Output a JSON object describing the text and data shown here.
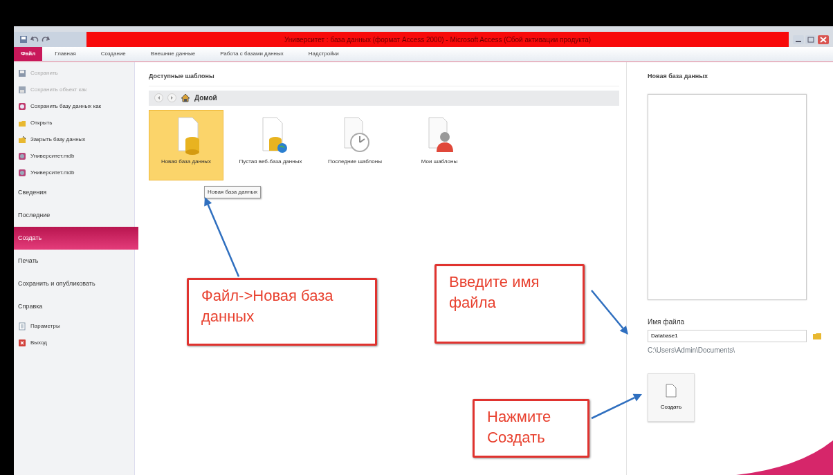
{
  "window": {
    "title": "Университет : база данных (формат Access 2000) - Microsoft Access (Сбой активации продукта)"
  },
  "ribbon_tabs": [
    {
      "label": "Файл",
      "selected": true
    },
    {
      "label": "Главная",
      "selected": false
    },
    {
      "label": "Создание",
      "selected": false
    },
    {
      "label": "Внешние данные",
      "selected": false
    },
    {
      "label": "Работа с базами данных",
      "selected": false
    },
    {
      "label": "Надстройки",
      "selected": false
    }
  ],
  "sidebar": {
    "items": [
      {
        "kind": "command",
        "label": "Сохранить",
        "disabled": true,
        "selected": false
      },
      {
        "kind": "command",
        "label": "Сохранить объект как",
        "disabled": true,
        "selected": false
      },
      {
        "kind": "command",
        "label": "Сохранить базу данных как",
        "disabled": false,
        "selected": false
      },
      {
        "kind": "command",
        "label": "Открыть",
        "disabled": false,
        "selected": false
      },
      {
        "kind": "command",
        "label": "Закрыть базу данных",
        "disabled": false,
        "selected": false
      },
      {
        "kind": "recent",
        "label": "Университет.mdb",
        "disabled": false,
        "selected": false
      },
      {
        "kind": "recent",
        "label": "Университет.mdb",
        "disabled": false,
        "selected": false
      },
      {
        "kind": "section",
        "label": "Сведения",
        "disabled": false,
        "selected": false
      },
      {
        "kind": "section",
        "label": "Последние",
        "disabled": false,
        "selected": false
      },
      {
        "kind": "section",
        "label": "Создать",
        "disabled": false,
        "selected": true
      },
      {
        "kind": "section",
        "label": "Печать",
        "disabled": false,
        "selected": false
      },
      {
        "kind": "section",
        "label": "Сохранить и опубликовать",
        "disabled": false,
        "selected": false
      },
      {
        "kind": "section",
        "label": "Справка",
        "disabled": false,
        "selected": false
      },
      {
        "kind": "command",
        "label": "Параметры",
        "disabled": false,
        "selected": false
      },
      {
        "kind": "command",
        "label": "Выход",
        "disabled": false,
        "selected": false
      }
    ]
  },
  "templates": {
    "heading": "Доступные шаблоны",
    "breadcrumb": "Домой",
    "items": [
      {
        "label": "Новая база данных",
        "selected": true
      },
      {
        "label": "Пустая веб-база данных",
        "selected": false
      },
      {
        "label": "Последние шаблоны",
        "selected": false
      },
      {
        "label": "Мои шаблоны",
        "selected": false
      }
    ],
    "tooltip": "Новая база данных"
  },
  "new_database": {
    "heading": "Новая база данных",
    "file_name_label": "Имя файла",
    "file_name": "Database1",
    "path": "C:\\Users\\Admin\\Documents\\",
    "create_button": "Создать"
  },
  "callouts": [
    {
      "text": "Файл->Новая база данных"
    },
    {
      "text": "Введите имя файла"
    },
    {
      "text": "Нажмите Создать"
    }
  ]
}
